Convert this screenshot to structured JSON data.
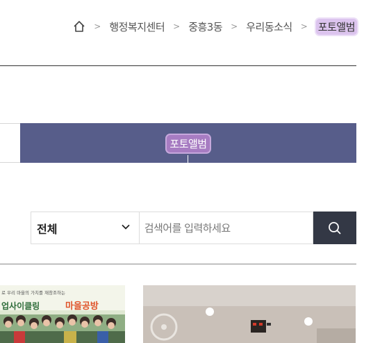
{
  "breadcrumb": {
    "items": [
      "행정복지센터",
      "중흥3동",
      "우리동소식"
    ],
    "current": "포토앨범"
  },
  "tabs": {
    "active_label": "포토앨범"
  },
  "search": {
    "category_value": "전체",
    "placeholder": "검색어를 입력하세요"
  },
  "gallery": {
    "banner_small_text": "로 우리 마을의 가치를 재창조하는",
    "banner_text_left": "업사이클링",
    "banner_text_right": "마을공방"
  },
  "colors": {
    "tab_active_bg": "#575d8a",
    "highlight": "#a77cc2",
    "search_button_bg": "#333845"
  }
}
